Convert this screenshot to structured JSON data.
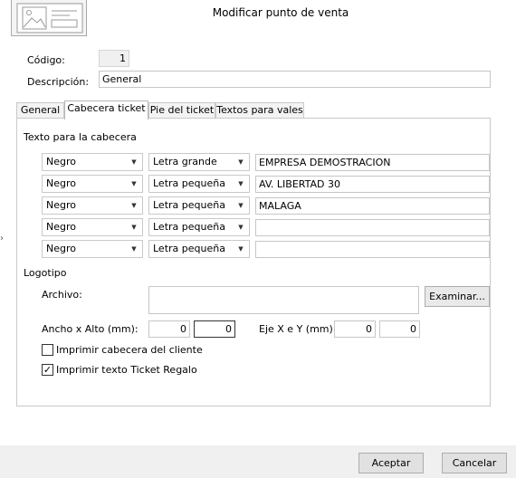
{
  "window": {
    "title": "Modificar punto de venta"
  },
  "fields": {
    "codigo_label": "Código:",
    "codigo_value": "1",
    "descripcion_label": "Descripción:",
    "descripcion_value": "General"
  },
  "tabs": [
    {
      "label": "General",
      "active": false
    },
    {
      "label": "Cabecera ticket",
      "active": true
    },
    {
      "label": "Pie del ticket",
      "active": false
    },
    {
      "label": "Textos para vales",
      "active": false
    }
  ],
  "header_section": {
    "title": "Texto para la cabecera",
    "rows": [
      {
        "color": "Negro",
        "size": "Letra grande",
        "text": "EMPRESA DEMOSTRACION"
      },
      {
        "color": "Negro",
        "size": "Letra pequeña",
        "text": "AV. LIBERTAD 30"
      },
      {
        "color": "Negro",
        "size": "Letra pequeña",
        "text": "MALAGA"
      },
      {
        "color": "Negro",
        "size": "Letra pequeña",
        "text": ""
      },
      {
        "color": "Negro",
        "size": "Letra pequeña",
        "text": ""
      }
    ]
  },
  "logo_section": {
    "title": "Logotipo",
    "archivo_label": "Archivo:",
    "archivo_value": "",
    "examinar_label": "Examinar...",
    "ancho_alto_label": "Ancho x Alto (mm):",
    "ancho_value": "0",
    "alto_value": "0",
    "eje_label": "Eje X e Y (mm):",
    "eje_x_value": "0",
    "eje_y_value": "0"
  },
  "options": {
    "imprimir_cabecera_label": "Imprimir cabecera del cliente",
    "imprimir_cabecera_checked": false,
    "imprimir_ticket_regalo_label": "Imprimir texto Ticket Regalo",
    "imprimir_ticket_regalo_checked": true
  },
  "footer": {
    "aceptar_label": "Aceptar",
    "cancelar_label": "Cancelar"
  },
  "colors": {
    "footer_bg": "#f0f0f0",
    "border": "#c9c9c9"
  }
}
